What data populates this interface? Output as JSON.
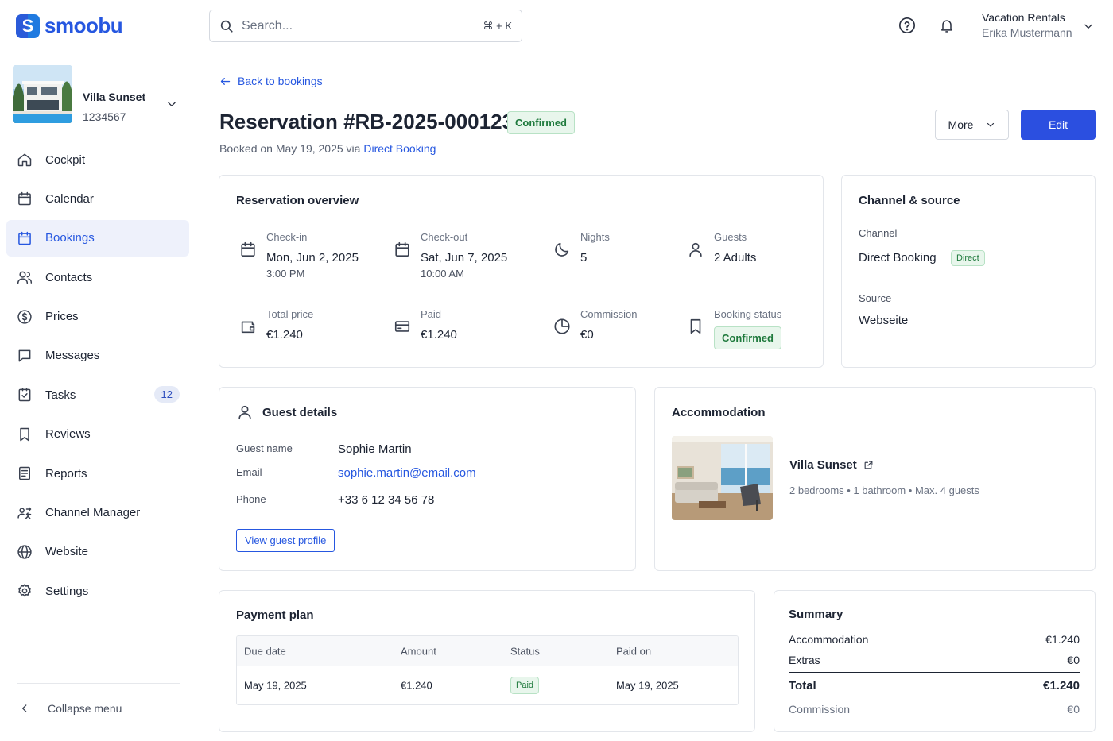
{
  "brand": {
    "name": "smoobu",
    "mark": "S"
  },
  "search": {
    "placeholder": "Search...",
    "shortcut": "⌘ + K"
  },
  "account": {
    "company": "Vacation Rentals",
    "user": "Erika Mustermann"
  },
  "property": {
    "name": "Villa Sunset",
    "id": "1234567"
  },
  "nav": [
    {
      "label": "Cockpit",
      "icon": "home-icon"
    },
    {
      "label": "Calendar",
      "icon": "calendar-icon"
    },
    {
      "label": "Bookings",
      "icon": "calendar-icon",
      "active": true
    },
    {
      "label": "Contacts",
      "icon": "contacts-icon"
    },
    {
      "label": "Prices",
      "icon": "dollar-icon"
    },
    {
      "label": "Messages",
      "icon": "message-icon"
    },
    {
      "label": "Tasks",
      "icon": "task-icon",
      "badge": "12"
    },
    {
      "label": "Reviews",
      "icon": "bookmark-icon"
    },
    {
      "label": "Reports",
      "icon": "report-icon"
    },
    {
      "label": "Channel Manager",
      "icon": "channel-icon"
    },
    {
      "label": "Website",
      "icon": "globe-icon"
    },
    {
      "label": "Settings",
      "icon": "gear-icon"
    }
  ],
  "collapse_label": "Collapse menu",
  "header": {
    "back_label": "Back to bookings",
    "title": "Reservation #RB-2025-000123",
    "status": "Confirmed",
    "booked_prefix": "Booked on May 19, 2025 via ",
    "booked_channel": "Direct Booking",
    "more_label": "More",
    "edit_label": "Edit"
  },
  "overview": {
    "title": "Reservation overview",
    "checkin": {
      "label": "Check-in",
      "value": "Mon, Jun 2, 2025",
      "sub": "3:00 PM"
    },
    "checkout": {
      "label": "Check-out",
      "value": "Sat, Jun 7, 2025",
      "sub": "10:00 AM"
    },
    "nights": {
      "label": "Nights",
      "value": "5"
    },
    "guests": {
      "label": "Guests",
      "value": "2 Adults"
    },
    "total": {
      "label": "Total price",
      "value": "€1.240"
    },
    "paid": {
      "label": "Paid",
      "value": "€1.240"
    },
    "commission": {
      "label": "Commission",
      "value": "€0"
    },
    "status": {
      "label": "Booking status",
      "value": "Confirmed"
    }
  },
  "channel": {
    "title": "Channel & source",
    "channel_label": "Channel",
    "channel_value": "Direct Booking",
    "channel_badge": "Direct",
    "source_label": "Source",
    "source_value": "Webseite"
  },
  "guest": {
    "title": "Guest details",
    "name_label": "Guest name",
    "name": "Sophie Martin",
    "email_label": "Email",
    "email": "sophie.martin@email.com",
    "phone_label": "Phone",
    "phone": "+33 6 12 34 56 78",
    "profile_button": "View guest profile"
  },
  "accommodation": {
    "title": "Accommodation",
    "name": "Villa Sunset",
    "meta": "2 bedrooms • 1 bathroom • Max. 4 guests"
  },
  "payment_plan": {
    "title": "Payment plan",
    "columns": [
      "Due date",
      "Amount",
      "Status",
      "Paid on"
    ],
    "rows": [
      {
        "due": "May 19, 2025",
        "amount": "€1.240",
        "status": "Paid",
        "paid_on": "May 19, 2025"
      }
    ]
  },
  "summary": {
    "title": "Summary",
    "accommodation_label": "Accommodation",
    "accommodation": "€1.240",
    "extras_label": "Extras",
    "extras": "€0",
    "total_label": "Total",
    "total": "€1.240",
    "commission_label": "Commission",
    "commission": "€0"
  },
  "colors": {
    "primary": "#2b4fe0",
    "link": "#2657e0",
    "success_bg": "#e8f6ec",
    "success_text": "#1f7a3d"
  }
}
